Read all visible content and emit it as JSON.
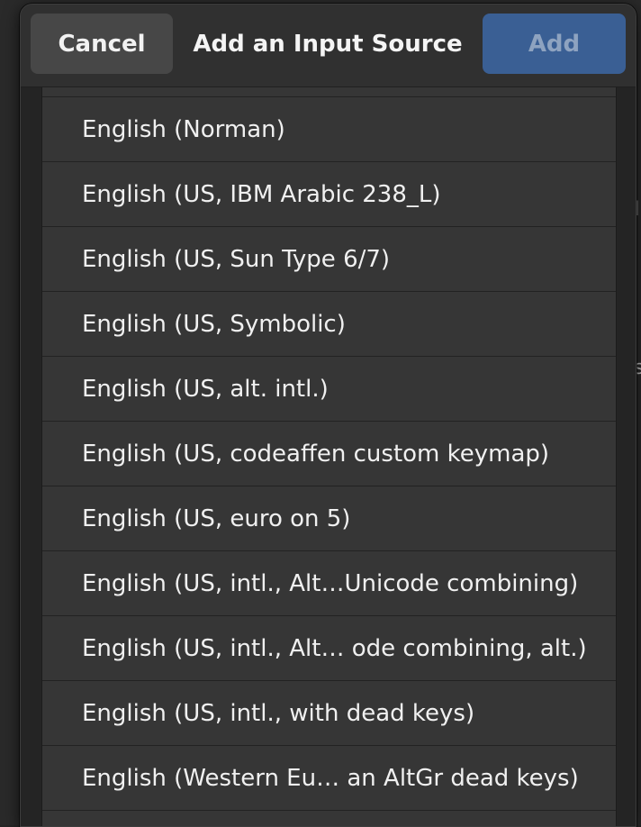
{
  "dialog": {
    "title": "Add an Input Source",
    "cancel_label": "Cancel",
    "add_label": "Add"
  },
  "layouts": [
    "English (Norman)",
    "English (US, IBM Arabic 238_L)",
    "English (US, Sun Type 6/7)",
    "English (US, Symbolic)",
    "English (US, alt. intl.)",
    "English (US, codeaffen custom keymap)",
    "English (US, euro on 5)",
    "English (US, intl., Alt…Unicode combining)",
    "English (US, intl., Alt… ode combining, alt.)",
    "English (US, intl., with dead keys)",
    "English (Western Eu… an AltGr dead keys)"
  ],
  "colors": {
    "accent": "#3a5f94",
    "row_bg": "#363636",
    "header_bg": "#303030"
  }
}
